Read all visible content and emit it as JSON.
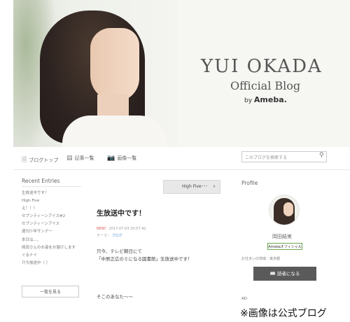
{
  "header": {
    "title": "YUI OKADA",
    "subtitle": "Official Blog",
    "by": "by",
    "platform": "Ameba."
  },
  "nav": {
    "items": [
      {
        "label": "ブログトップ",
        "icon": "document-icon"
      },
      {
        "label": "記事一覧",
        "icon": "list-icon"
      },
      {
        "label": "画像一覧",
        "icon": "camera-icon"
      }
    ],
    "search_placeholder": "このブログを検索する"
  },
  "sidebar": {
    "heading": "Recent Entries",
    "entries": [
      "生放送中です！",
      "High Five",
      "え！！！",
      "セブンティーンアイス#2",
      "セブンティーンアイス",
      "週刊少年サンデー",
      "本日は、、、",
      "岡田さんのお姿をお届けします",
      "ぐるナイ",
      "只今放送中（ ）"
    ],
    "more_label": "一覧を見る"
  },
  "post": {
    "next_label": "High Five･･･",
    "title": "生放送中です！",
    "new_badge": "NEW!",
    "date": "2017-07-03 20:57:42",
    "theme_label": "テーマ：",
    "theme_link": "ブログ",
    "body_line1": "只今、テレビ朝日にて",
    "body_line2": "「中居正広のミになる図書館」生放送中です！",
    "body_line3": "そこのあなた～～"
  },
  "profile": {
    "heading": "Profile",
    "name": "岡田結実",
    "badge": "Amebaオフィシャル",
    "location": "お住まいの地域：東京都",
    "reader_button": "読者になる",
    "ad_label": "AD"
  },
  "caption": "※画像は公式ブログ"
}
